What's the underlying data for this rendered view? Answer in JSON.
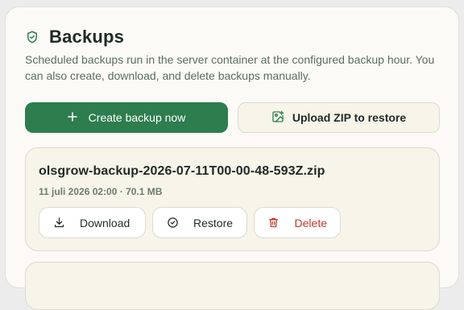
{
  "section": {
    "title": "Backups",
    "description": "Scheduled backups run in the server container at the configured backup hour. You can also create, download, and delete backups manually."
  },
  "buttons": {
    "create_label": "Create backup now",
    "upload_label": "Upload ZIP to restore"
  },
  "backups": [
    {
      "filename": "olsgrow-backup-2026-07-11T00-00-48-593Z.zip",
      "meta": "11 juli 2026 02:00 · 70.1 MB",
      "actions": {
        "download": "Download",
        "restore": "Restore",
        "delete": "Delete"
      }
    }
  ],
  "icons": {
    "header": "shield-check-icon",
    "create": "plus-icon",
    "upload": "image-plus-icon",
    "download": "download-icon",
    "restore": "check-circle-icon",
    "delete": "trash-icon"
  },
  "colors": {
    "accent": "#2e7d4e",
    "danger": "#c0392b",
    "text": "#1f2a24",
    "muted": "#5a6e62"
  }
}
